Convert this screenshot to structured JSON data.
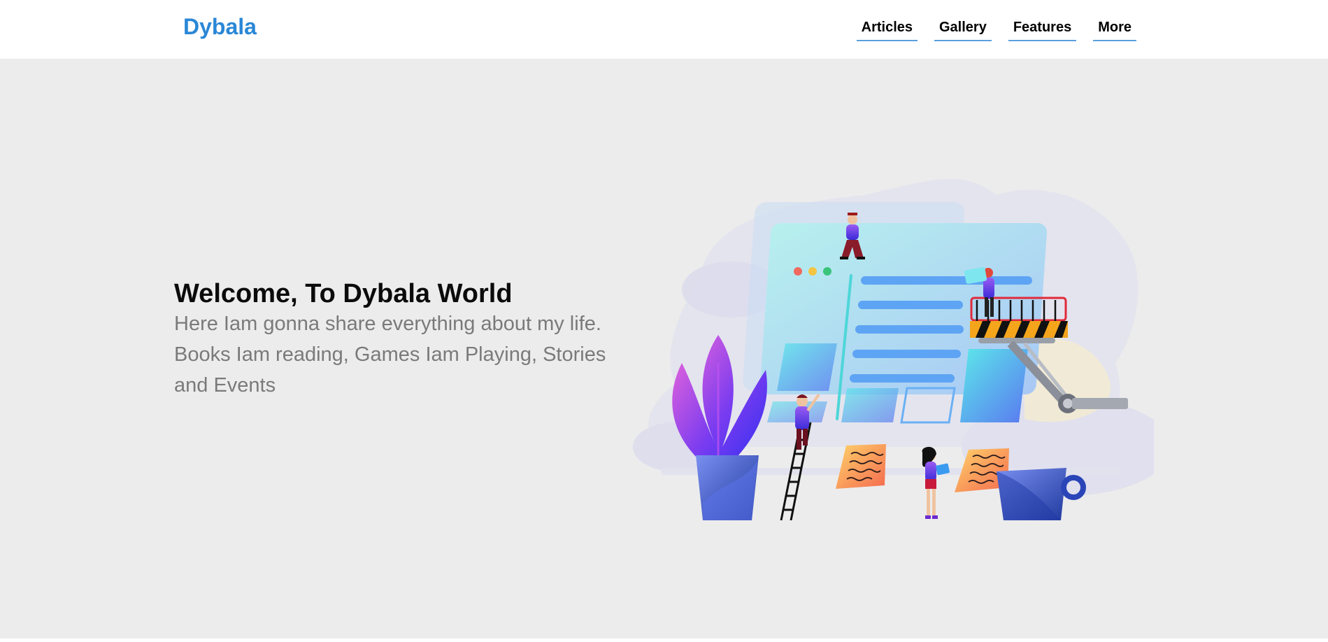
{
  "navbar": {
    "brand": "Dybala",
    "links": [
      {
        "label": "Articles"
      },
      {
        "label": "Gallery"
      },
      {
        "label": "Features"
      },
      {
        "label": "More"
      }
    ]
  },
  "hero": {
    "title": "Welcome, To Dybala World",
    "description": "Here Iam gonna share everything about my life. Books Iam reading, Games Iam Playing, Stories and Events",
    "illustration_icon": "website-construction-illustration"
  },
  "colors": {
    "brand": "#2a87d6",
    "nav_underline": "#5aa0de",
    "hero_background": "#ececec",
    "title_text": "#0b0b0b",
    "body_text": "#7a7a7a"
  }
}
